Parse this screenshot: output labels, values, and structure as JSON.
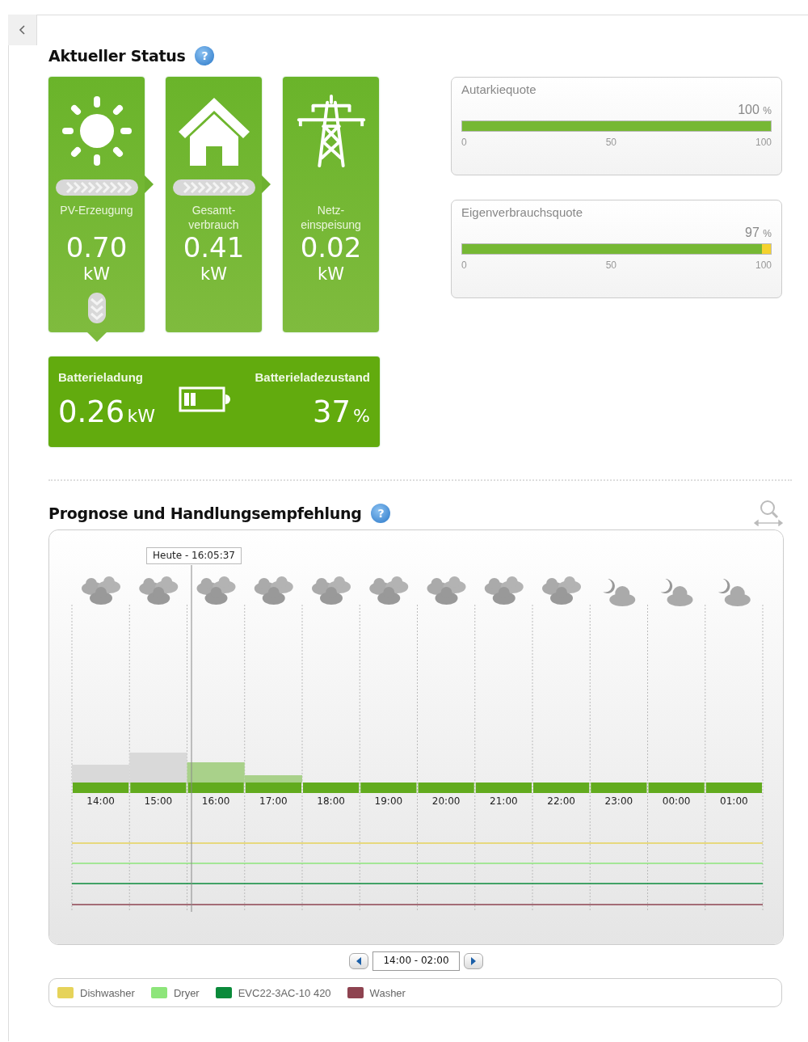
{
  "status": {
    "title": "Aktueller Status",
    "help": "?",
    "tiles": [
      {
        "kind": "generation",
        "label": [
          "PV-Erzeugung"
        ],
        "value": "0.70",
        "unit": "kW",
        "flow_right": true,
        "flow_down": true
      },
      {
        "kind": "consumption",
        "label": [
          "Gesamt-",
          "verbrauch"
        ],
        "value": "0.41",
        "unit": "kW",
        "flow_right": true,
        "flow_down": false
      },
      {
        "kind": "feed-in",
        "label": [
          "Netz-",
          "einspeisung"
        ],
        "value": "0.02",
        "unit": "kW",
        "flow_right": false,
        "flow_down": false
      }
    ],
    "battery": {
      "charge_label": "Batterieladung",
      "charge_value": "0.26",
      "charge_unit": "kW",
      "soc_label": "Batterieladezustand",
      "soc_value": "37",
      "soc_unit": "%"
    },
    "gauges": [
      {
        "title": "Autarkiequote",
        "reading": "100",
        "unit": "%",
        "level": 1.0,
        "ticks": [
          "0",
          "50",
          "100"
        ]
      },
      {
        "title": "Eigenverbrauchsquote",
        "reading": "97",
        "unit": "%",
        "level": 0.97,
        "ticks": [
          "0",
          "50",
          "100"
        ]
      }
    ]
  },
  "forecast": {
    "title": "Prognose und Handlungsempfehlung",
    "help": "?",
    "now_label": "Heute - 16:05:37",
    "hours": [
      {
        "label": "14:00",
        "kind": "cloudy"
      },
      {
        "label": "15:00",
        "kind": "cloudy"
      },
      {
        "label": "16:00",
        "kind": "cloudy"
      },
      {
        "label": "17:00",
        "kind": "cloudy"
      },
      {
        "label": "18:00",
        "kind": "cloudy"
      },
      {
        "label": "19:00",
        "kind": "cloudy"
      },
      {
        "label": "20:00",
        "kind": "cloudy"
      },
      {
        "label": "21:00",
        "kind": "cloudy"
      },
      {
        "label": "22:00",
        "kind": "cloudy"
      },
      {
        "label": "23:00",
        "kind": "night"
      },
      {
        "label": "00:00",
        "kind": "night"
      },
      {
        "label": "01:00",
        "kind": "night"
      }
    ],
    "range": "14:00 - 02:00",
    "legend": [
      {
        "label": "Dishwasher",
        "color": "#e6d35a"
      },
      {
        "label": "Dryer",
        "color": "#8de57a"
      },
      {
        "label": "EVC22-3AC-10 420",
        "color": "#0a8a3a"
      },
      {
        "label": "Washer",
        "color": "#8e4350"
      }
    ]
  }
}
